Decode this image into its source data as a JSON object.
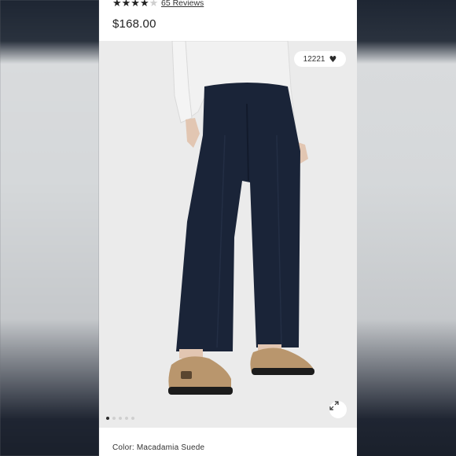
{
  "product": {
    "rating_stars": "★★★★",
    "rating_stars_empty": "★",
    "review_count_label": "65 Reviews",
    "price": "$168.00",
    "color_label": "Color: Macadamia Suede"
  },
  "gallery": {
    "likes_count": "12221",
    "current_slide": 1,
    "total_slides": 5,
    "heart_icon": "heart-icon",
    "expand_icon": "expand-arrows-icon"
  },
  "colors": {
    "pants": "#1a2438",
    "background": "#ebebeb",
    "shoes": "#b9966d"
  }
}
